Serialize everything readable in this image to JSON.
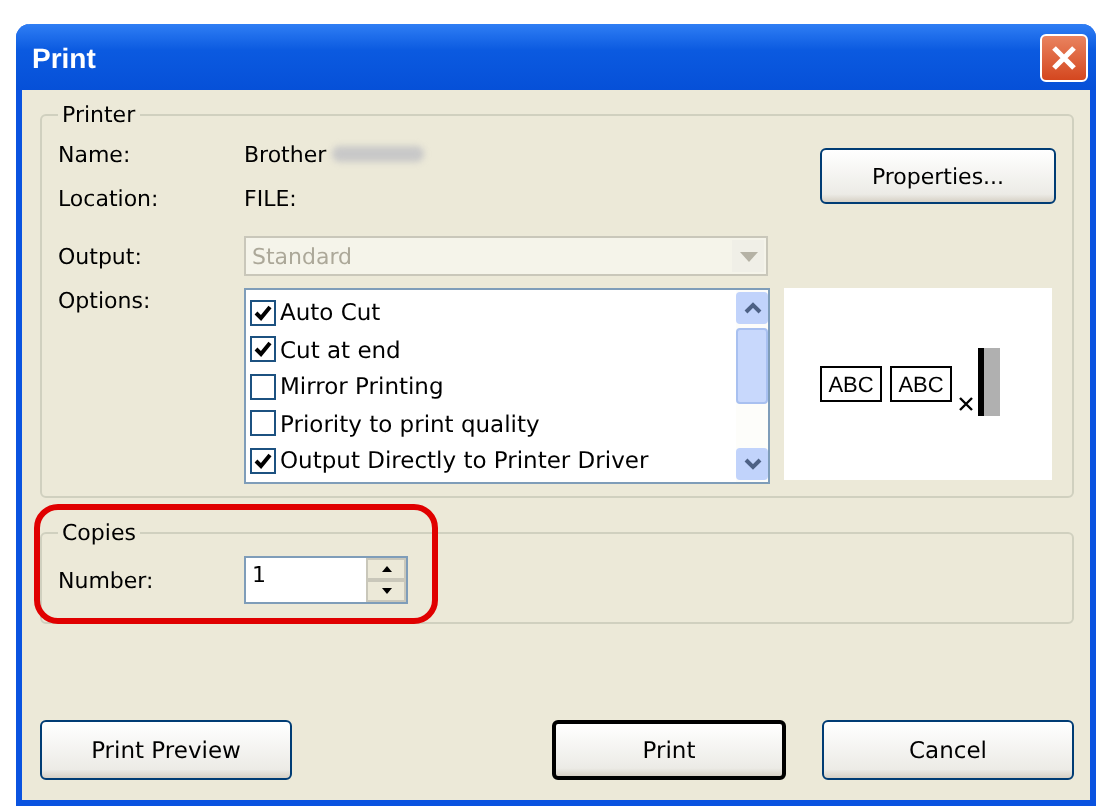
{
  "window": {
    "title": "Print"
  },
  "printer": {
    "group_label": "Printer",
    "fields": [
      {
        "label": "Name:",
        "value": "Brother",
        "redacted": true
      },
      {
        "label": "Location:",
        "value": "FILE:",
        "redacted": false
      }
    ],
    "properties_button": "Properties...",
    "output": {
      "label": "Output:",
      "value": "Standard",
      "disabled": true
    },
    "options_label": "Options:",
    "options": [
      {
        "label": "Auto Cut",
        "checked": true
      },
      {
        "label": "Cut at end",
        "checked": true
      },
      {
        "label": "Mirror Printing",
        "checked": false
      },
      {
        "label": "Priority to print quality",
        "checked": false
      },
      {
        "label": "Output Directly to Printer Driver",
        "checked": true
      }
    ],
    "preview_labels": [
      "ABC",
      "ABC"
    ]
  },
  "copies": {
    "group_label": "Copies",
    "label": "Number:",
    "value": "1",
    "highlighted": true
  },
  "buttons": [
    {
      "label": "Print Preview",
      "default": false
    },
    {
      "label": "Print",
      "default": true
    },
    {
      "label": "Cancel",
      "default": false
    }
  ]
}
